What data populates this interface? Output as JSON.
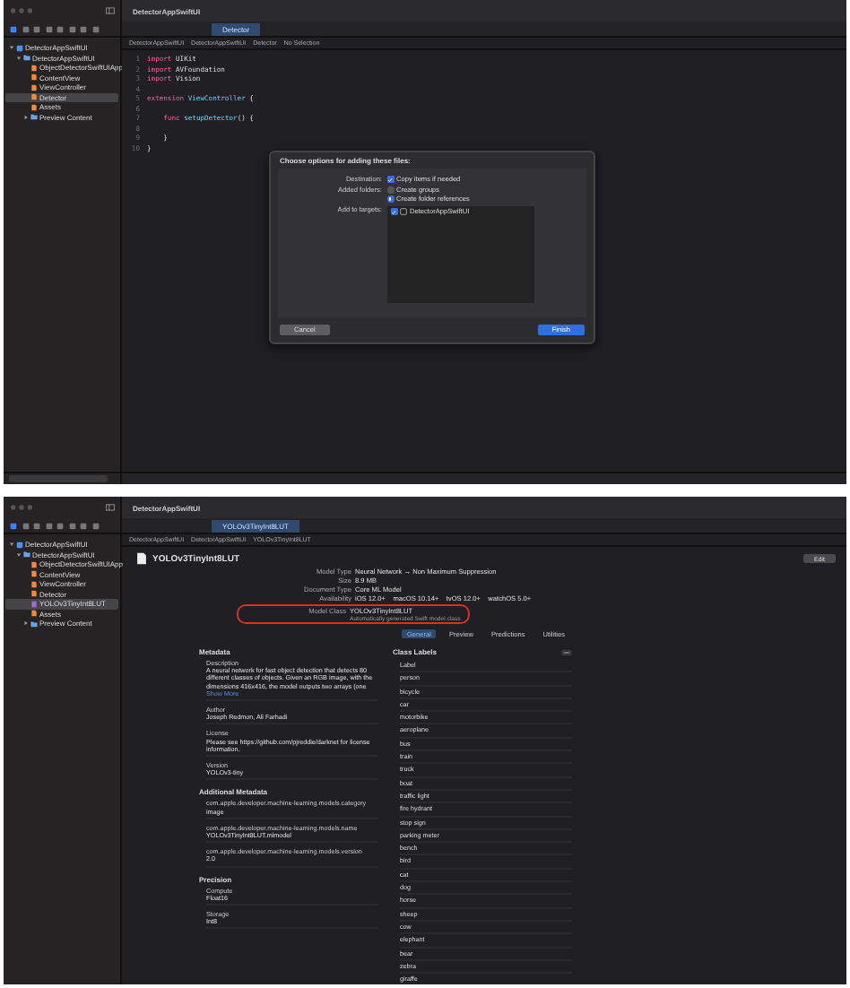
{
  "top_window": {
    "title": "DetectorAppSwiftUI",
    "tabs": [
      {
        "label": "Detector",
        "selected": true
      }
    ],
    "breadcrumb": [
      "DetectorAppSwiftUI",
      "DetectorAppSwiftUI",
      "Detector",
      "No Selection"
    ],
    "sidebar": {
      "items": [
        {
          "label": "DetectorAppSwiftUI",
          "kind": "project",
          "expanded": true,
          "selected": false,
          "children": [
            {
              "label": "DetectorAppSwiftUI",
              "kind": "folder",
              "expanded": true,
              "selected": false,
              "children": [
                {
                  "label": "ObjectDetectorSwiftUIApp",
                  "kind": "file",
                  "selected": false
                },
                {
                  "label": "ContentView",
                  "kind": "file",
                  "selected": false
                },
                {
                  "label": "ViewController",
                  "kind": "file",
                  "selected": false
                },
                {
                  "label": "Detector",
                  "kind": "file",
                  "selected": true
                },
                {
                  "label": "Assets",
                  "kind": "file",
                  "selected": false
                },
                {
                  "label": "Preview Content",
                  "kind": "folder",
                  "expanded": false,
                  "selected": false
                }
              ]
            }
          ]
        }
      ]
    },
    "editor": {
      "lines": [
        {
          "number": "1",
          "tokens": [
            {
              "kind": "keyword",
              "text": "import"
            },
            {
              "kind": "plain",
              "text": " UIKit"
            }
          ]
        },
        {
          "number": "2",
          "tokens": [
            {
              "kind": "keyword",
              "text": "import"
            },
            {
              "kind": "plain",
              "text": " AVFoundation"
            }
          ]
        },
        {
          "number": "3",
          "tokens": [
            {
              "kind": "keyword",
              "text": "import"
            },
            {
              "kind": "plain",
              "text": " Vision"
            }
          ]
        },
        {
          "number": "4"
        },
        {
          "number": "5",
          "tokens": [
            {
              "kind": "keyword",
              "text": "extension"
            },
            {
              "kind": "type",
              "text": " ViewController"
            },
            {
              "kind": "plain",
              "text": " {"
            }
          ]
        },
        {
          "number": "6"
        },
        {
          "number": "7",
          "tokens": [
            {
              "kind": "keyword",
              "text": "    func"
            },
            {
              "kind": "type",
              "text": " setupDetector"
            },
            {
              "kind": "plain",
              "text": "() {"
            }
          ]
        },
        {
          "number": "8"
        },
        {
          "number": "9",
          "tokens": [
            {
              "kind": "plain",
              "text": "    }"
            }
          ]
        },
        {
          "number": "10",
          "tokens": [
            {
              "kind": "plain",
              "text": "}"
            }
          ]
        }
      ]
    },
    "dialog": {
      "title": "Choose options for adding these files:",
      "rows": [
        {
          "label": "Destination:",
          "options": [
            {
              "kind": "checkbox",
              "text": "Copy items if needed",
              "checked": true
            }
          ]
        },
        {
          "label": "Added folders:",
          "options": [
            {
              "kind": "radio",
              "text": "Create groups",
              "checked": false
            },
            {
              "kind": "radio",
              "text": "Create folder references",
              "checked": true
            }
          ]
        }
      ],
      "targets": {
        "label": "Add to targets:",
        "items": [
          {
            "text": "DetectorAppSwiftUI",
            "checked": true
          }
        ]
      },
      "buttons": [
        {
          "label": "Cancel",
          "kind": "secondary"
        },
        {
          "label": "Finish",
          "kind": "primary"
        }
      ]
    }
  },
  "bottom_window": {
    "title": "DetectorAppSwiftUI",
    "tabs": [
      {
        "label": "YOLOv3TinyInt8LUT",
        "selected": true
      }
    ],
    "breadcrumb": [
      "DetectorAppSwiftUI",
      "DetectorAppSwiftUI",
      "YOLOv3TinyInt8LUT"
    ],
    "sidebar": {
      "items": [
        {
          "label": "DetectorAppSwiftUI",
          "kind": "project",
          "expanded": true,
          "selected": false,
          "children": [
            {
              "label": "DetectorAppSwiftUI",
              "kind": "folder",
              "expanded": true,
              "selected": false,
              "children": [
                {
                  "label": "ObjectDetectorSwiftUIApp",
                  "kind": "file",
                  "selected": false
                },
                {
                  "label": "ContentView",
                  "kind": "file",
                  "selected": false
                },
                {
                  "label": "ViewController",
                  "kind": "file",
                  "selected": false
                },
                {
                  "label": "Detector",
                  "kind": "file",
                  "selected": false
                },
                {
                  "label": "YOLOv3TinyInt8LUT",
                  "kind": "model",
                  "selected": true
                },
                {
                  "label": "Assets",
                  "kind": "file",
                  "selected": false
                },
                {
                  "label": "Preview Content",
                  "kind": "folder",
                  "expanded": false,
                  "selected": false
                }
              ]
            }
          ]
        }
      ]
    },
    "model": {
      "name": "YOLOv3TinyInt8LUT",
      "edit_button": "Edit",
      "info": [
        {
          "label": "Model Type",
          "value": "Neural Network → Non Maximum Suppression"
        },
        {
          "label": "Size",
          "value": "8.9 MB"
        },
        {
          "label": "Document Type",
          "value": "Core ML Model"
        },
        {
          "label": "Availability",
          "value": "iOS 12.0+    macOS 10.14+    tvOS 12.0+    watchOS 5.0+"
        }
      ],
      "model_class": {
        "label": "Model Class",
        "value": "YOLOv3TinyInt8LUT",
        "note": "Automatically generated Swift model class",
        "highlighted": true
      },
      "tabs": [
        {
          "label": "General",
          "selected": true
        },
        {
          "label": "Preview",
          "selected": false
        },
        {
          "label": "Predictions",
          "selected": false
        },
        {
          "label": "Utilities",
          "selected": false
        }
      ],
      "metadata": {
        "title": "Metadata",
        "entries": [
          {
            "label": "Description",
            "value": "A neural network for fast object detection that detects 80 different classes of objects. Given an RGB image, with the dimensions 416x416, the model outputs two arrays (one",
            "link": "Show More"
          },
          {
            "label": "Author",
            "value": "Joseph Redmon, Ali Farhadi"
          },
          {
            "label": "License",
            "value": "Please see https://github.com/pjreddie/darknet for license information."
          },
          {
            "label": "Version",
            "value": "YOLOv3-tiny"
          }
        ]
      },
      "additional_metadata": {
        "title": "Additional Metadata",
        "entries": [
          {
            "label": "com.apple.developer.machine-learning.models.category",
            "value": "image"
          },
          {
            "label": "com.apple.developer.machine-learning.models.name",
            "value": "YOLOv3TinyInt8LUT.mlmodel"
          },
          {
            "label": "com.apple.developer.machine-learning.models.version",
            "value": "2.0"
          }
        ]
      },
      "precision": {
        "title": "Precision",
        "entries": [
          {
            "label": "Compute",
            "value": "Float16"
          },
          {
            "label": "Storage",
            "value": "Int8"
          }
        ]
      },
      "class_labels": {
        "title": "Class Labels",
        "items": [
          "Label",
          "person",
          "bicycle",
          "car",
          "motorbike",
          "aeroplane",
          "bus",
          "train",
          "truck",
          "boat",
          "traffic light",
          "fire hydrant",
          "stop sign",
          "parking meter",
          "bench",
          "bird",
          "cat",
          "dog",
          "horse",
          "sheep",
          "cow",
          "elephant",
          "bear",
          "zebra",
          "giraffe"
        ]
      }
    }
  }
}
